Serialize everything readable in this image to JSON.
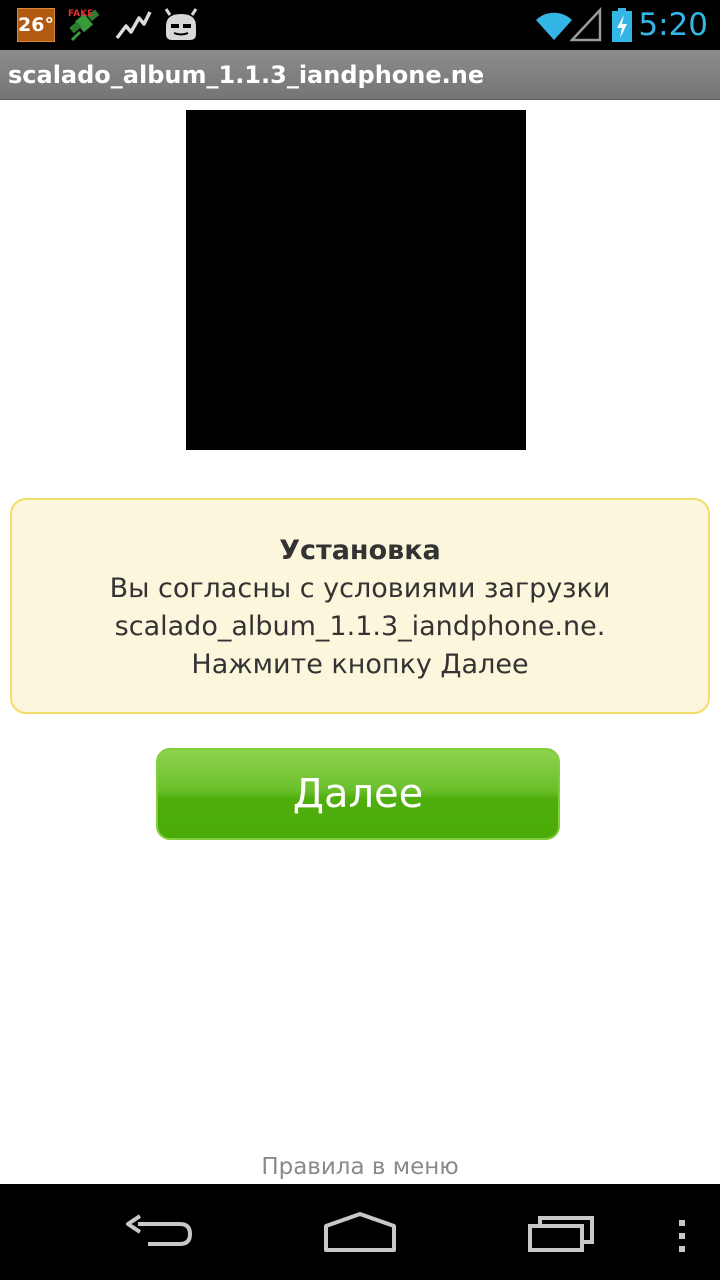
{
  "status_bar": {
    "temperature": "26°",
    "time": "5:20",
    "icons": [
      "temperature-icon",
      "fake-gps-satellite-icon",
      "activity-graph-icon",
      "cyanogenmod-android-icon",
      "wifi-icon",
      "cell-signal-icon",
      "battery-charging-icon"
    ]
  },
  "title_bar": {
    "title": "scalado_album_1.1.3_iandphone.ne"
  },
  "info_box": {
    "title": "Установка",
    "line1": "Вы согласны с условиями загрузки",
    "line2": "scalado_album_1.1.3_iandphone.ne.",
    "line3": "Нажмите кнопку Далее"
  },
  "button": {
    "label": "Далее"
  },
  "footer": {
    "rules_link": "Правила в меню"
  },
  "nav_bar": {
    "icons": [
      "back-icon",
      "home-icon",
      "recent-apps-icon",
      "menu-overflow-icon"
    ]
  },
  "colors": {
    "status_time": "#33b5e5",
    "info_bg": "#fcf6dc",
    "info_border": "#f2dd6b",
    "button_green": "#4aaa08"
  }
}
